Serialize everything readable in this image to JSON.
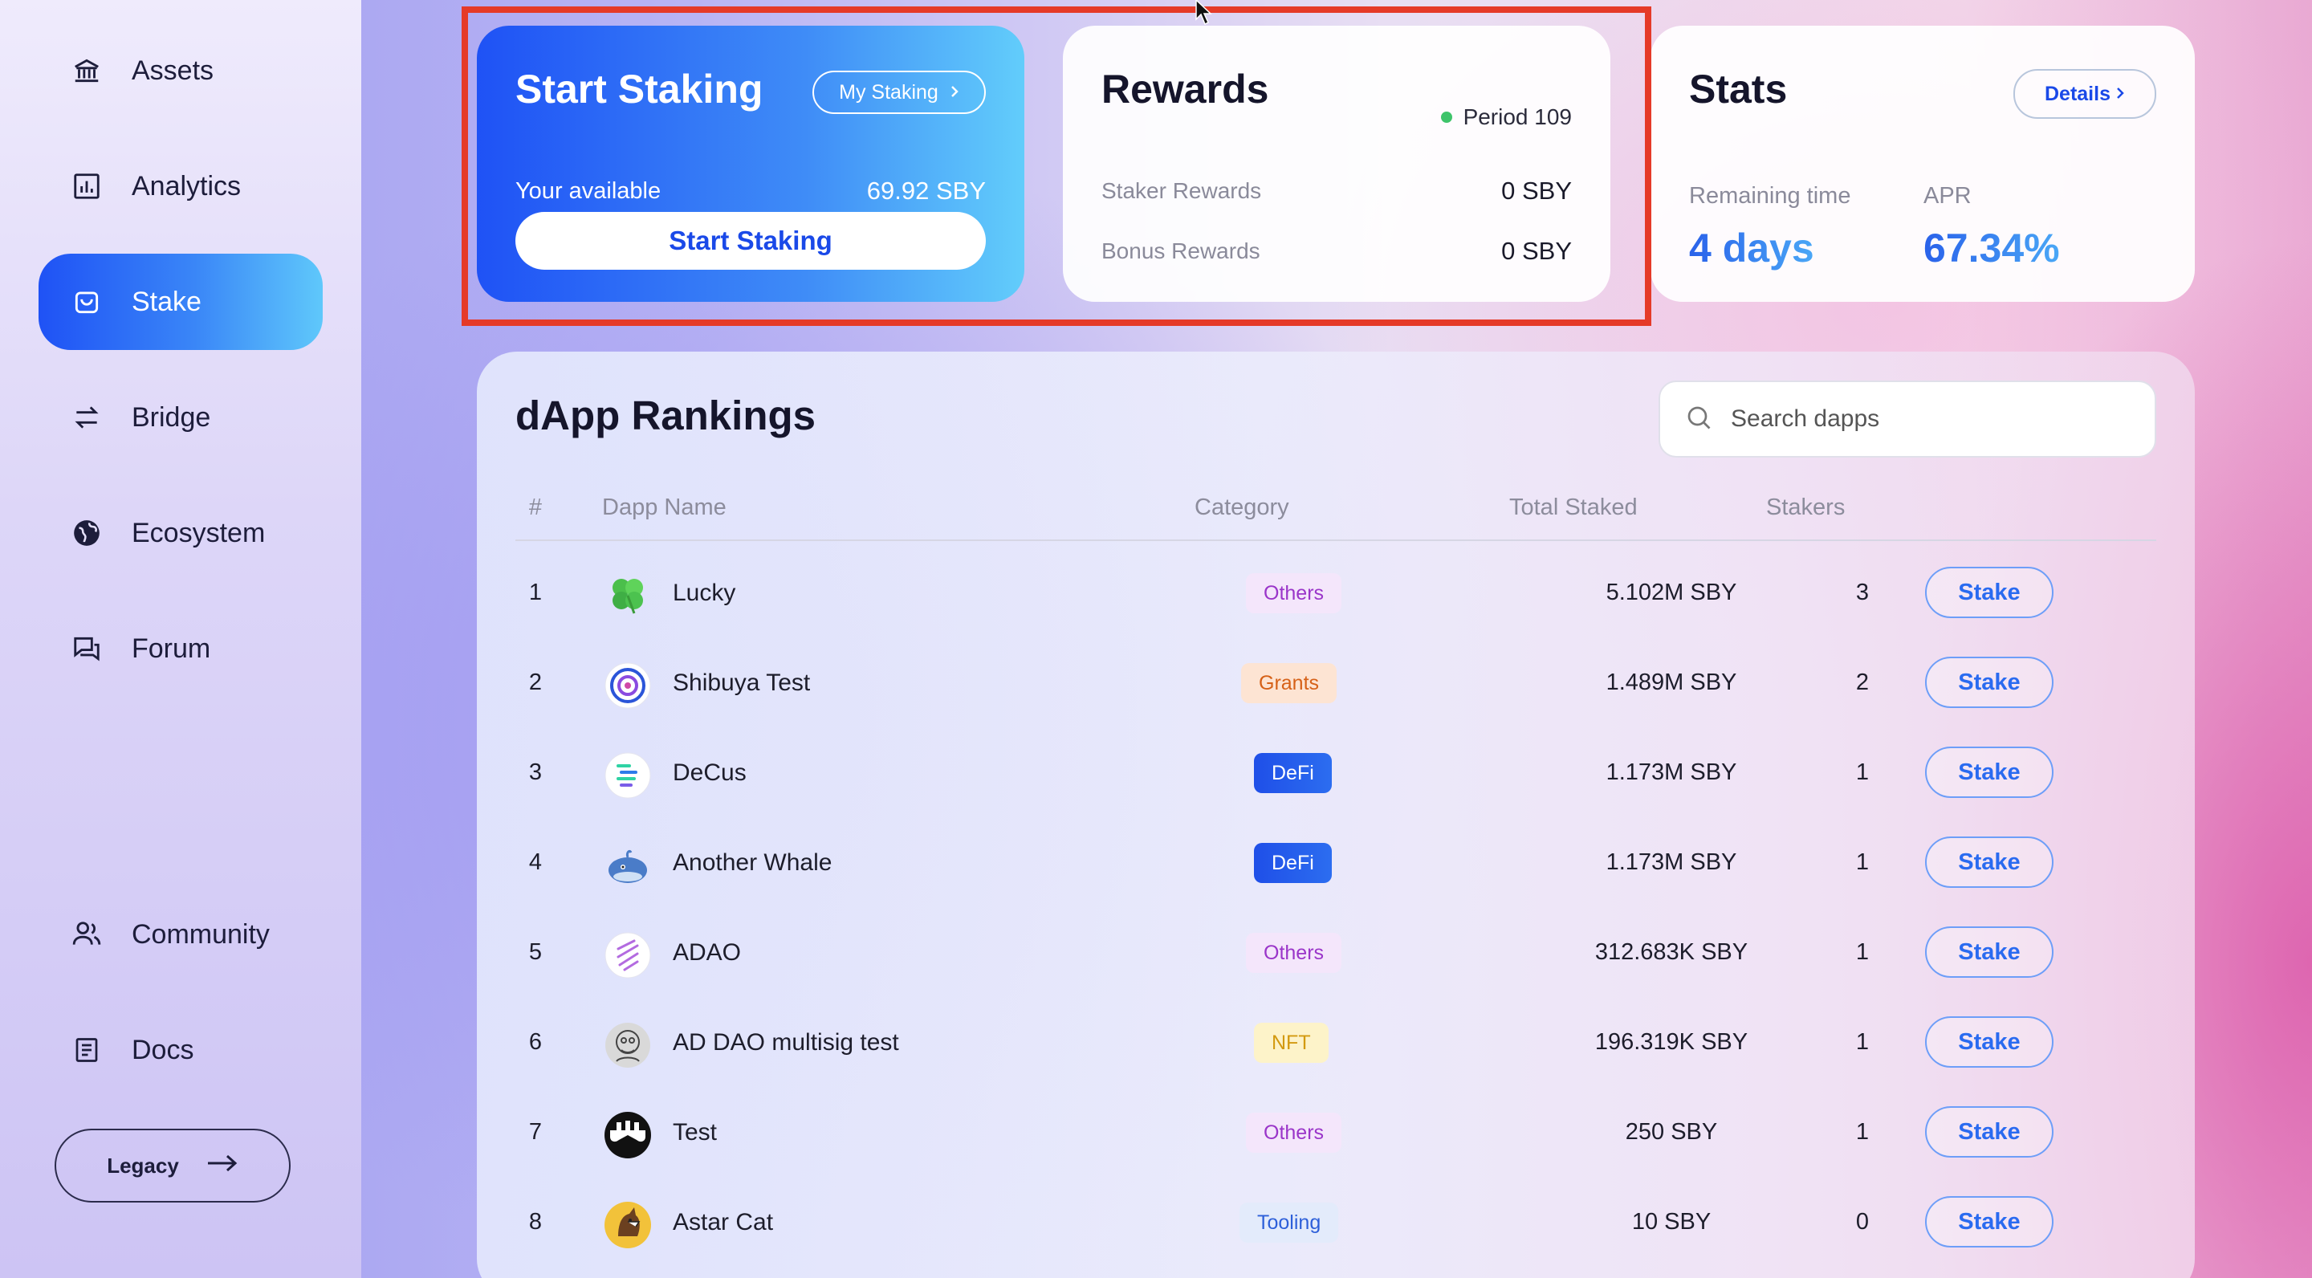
{
  "sidebar": {
    "items": [
      {
        "label": "Assets",
        "icon": "bank-icon"
      },
      {
        "label": "Analytics",
        "icon": "chart-icon"
      },
      {
        "label": "Stake",
        "icon": "bag-icon",
        "active": true
      },
      {
        "label": "Bridge",
        "icon": "arrows-icon"
      },
      {
        "label": "Ecosystem",
        "icon": "globe-icon"
      },
      {
        "label": "Forum",
        "icon": "chat-icon"
      },
      {
        "label": "Community",
        "icon": "users-icon"
      },
      {
        "label": "Docs",
        "icon": "document-icon"
      }
    ],
    "legacy_label": "Legacy"
  },
  "start_card": {
    "title": "Start Staking",
    "my_staking_label": "My Staking",
    "available_label": "Your available",
    "available_value": "69.92 SBY",
    "button_label": "Start Staking"
  },
  "rewards_card": {
    "title": "Rewards",
    "period": "Period 109",
    "staker_label": "Staker Rewards",
    "staker_value": "0 SBY",
    "bonus_label": "Bonus Rewards",
    "bonus_value": "0 SBY"
  },
  "stats_card": {
    "title": "Stats",
    "details_label": "Details",
    "remaining_label": "Remaining time",
    "remaining_value": "4 days",
    "apr_label": "APR",
    "apr_value": "67.34%"
  },
  "rankings": {
    "title": "dApp Rankings",
    "search_placeholder": "Search dapps",
    "columns": [
      "#",
      "Dapp Name",
      "Category",
      "Total Staked",
      "Stakers"
    ],
    "stake_label": "Stake",
    "rows": [
      {
        "num": "1",
        "name": "Lucky",
        "category": "Others",
        "total": "5.102M SBY",
        "stakers": "3"
      },
      {
        "num": "2",
        "name": "Shibuya Test",
        "category": "Grants",
        "total": "1.489M SBY",
        "stakers": "2"
      },
      {
        "num": "3",
        "name": "DeCus",
        "category": "DeFi",
        "total": "1.173M SBY",
        "stakers": "1"
      },
      {
        "num": "4",
        "name": "Another Whale",
        "category": "DeFi",
        "total": "1.173M SBY",
        "stakers": "1"
      },
      {
        "num": "5",
        "name": "ADAO",
        "category": "Others",
        "total": "312.683K SBY",
        "stakers": "1"
      },
      {
        "num": "6",
        "name": "AD DAO multisig test",
        "category": "NFT",
        "total": "196.319K SBY",
        "stakers": "1"
      },
      {
        "num": "7",
        "name": "Test",
        "category": "Others",
        "total": "250 SBY",
        "stakers": "1"
      },
      {
        "num": "8",
        "name": "Astar Cat",
        "category": "Tooling",
        "total": "10 SBY",
        "stakers": "0"
      }
    ]
  },
  "colors": {
    "accent": "#1f52f5",
    "highlight": "#e53a28",
    "period_dot": "#3ec46a"
  }
}
